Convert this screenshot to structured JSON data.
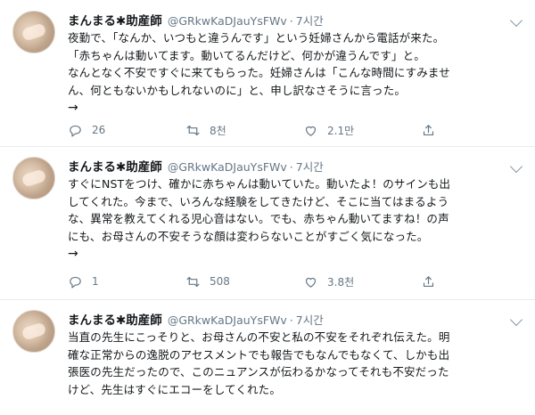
{
  "tweets": [
    {
      "name": "まんまる✱助産師",
      "handle": "@GRkwKaDJauYsFWv",
      "dot": "·",
      "time": "7시간",
      "lines": [
        "夜勤で、「なんか、いつもと違うんです」という妊婦さんから電話が来た。",
        "「赤ちゃんは動いてます。動いてるんだけど、何かが違うんです」と。",
        "なんとなく不安ですぐに来てもらった。妊婦さんは「こんな時間にすみませ",
        "ん、何ともないかもしれないのに」と、申し訳なさそうに言った。"
      ],
      "arrow": "→",
      "replies": "26",
      "retweets": "8천",
      "likes": "2.1만"
    },
    {
      "name": "まんまる✱助産師",
      "handle": "@GRkwKaDJauYsFWv",
      "dot": "·",
      "time": "7시간",
      "lines": [
        "すぐにNSTをつけ、確かに赤ちゃんは動いていた。動いたよ！のサインも出",
        "してくれた。今まで、いろんな経験をしてきたけど、そこに当てはまるよう",
        "な、異常を教えてくれる児心音はない。でも、赤ちゃん動いてますね！の声",
        "にも、お母さんの不安そうな顔は変わらないことがすごく気になった。"
      ],
      "arrow": "→",
      "replies": "1",
      "retweets": "508",
      "likes": "3.8천"
    },
    {
      "name": "まんまる✱助産師",
      "handle": "@GRkwKaDJauYsFWv",
      "dot": "·",
      "time": "7시간",
      "lines": [
        "当直の先生にこっそりと、お母さんの不安と私の不安をそれぞれ伝えた。明",
        "確な正常からの逸脱のアセスメントでも報告でもなんでもなくて、しかも出",
        "張医の先生だったので、このニュアンスが伝わるかなってそれも不安だった",
        "けど、先生はすぐにエコーをしてくれた。"
      ]
    }
  ],
  "icons": {
    "reply": "reply-icon",
    "retweet": "retweet-icon",
    "like": "heart-icon",
    "share": "share-icon",
    "menu": "chevron-down-icon"
  },
  "colors": {
    "text": "#14171a",
    "muted": "#657786",
    "divider": "#e6ecf0"
  }
}
